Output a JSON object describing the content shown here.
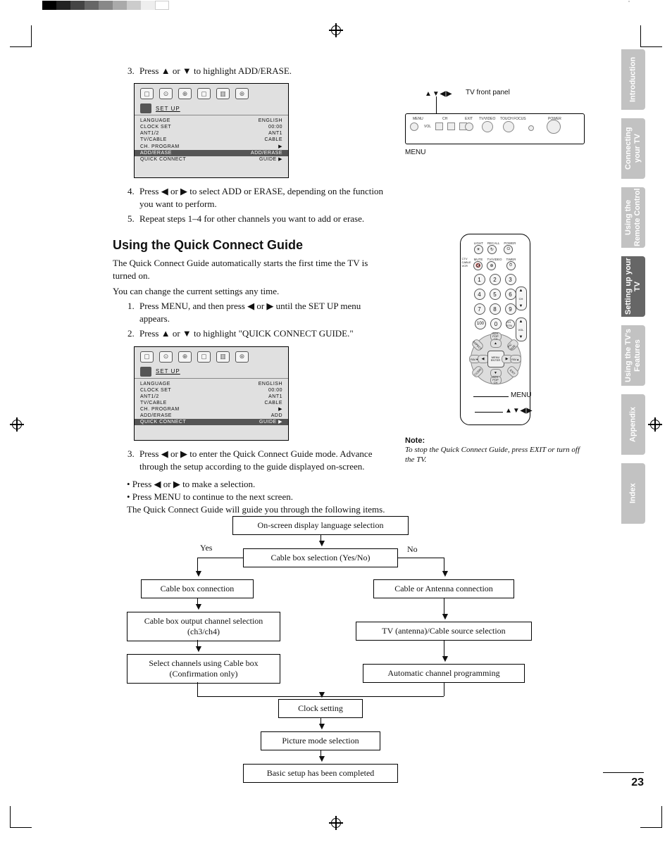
{
  "steps_a": {
    "s3": "Press ▲ or ▼ to highlight ADD/ERASE.",
    "s4": "Press ◀ or ▶ to select ADD or ERASE, depending on the function you want to perform.",
    "s5": "Repeat steps 1–4 for other channels you want to add or erase."
  },
  "osd1": {
    "title": "SET UP",
    "rows": [
      {
        "k": "LANGUAGE",
        "v": "ENGLISH"
      },
      {
        "k": "CLOCK SET",
        "v": "00:00"
      },
      {
        "k": "ANT1/2",
        "v": "ANT1"
      },
      {
        "k": "TV/CABLE",
        "v": "CABLE"
      },
      {
        "k": "CH. PROGRAM",
        "v": "▶"
      }
    ],
    "hl": {
      "k": "ADD/ERASE",
      "v": "ADD/ERASE"
    },
    "foot": {
      "k": "QUICK CONNECT",
      "v": "GUIDE             ▶"
    }
  },
  "section_title": "Using the Quick Connect Guide",
  "intro1": "The Quick Connect Guide automatically starts the first time the TV is turned on.",
  "intro2": "You can change the current settings any time.",
  "steps_b": {
    "s1": "Press MENU, and then press ◀ or ▶ until the SET UP menu appears.",
    "s2": "Press ▲ or ▼ to highlight \"QUICK CONNECT GUIDE.\""
  },
  "osd2": {
    "title": "SET UP",
    "rows": [
      {
        "k": "LANGUAGE",
        "v": "ENGLISH"
      },
      {
        "k": "CLOCK SET",
        "v": "00:00"
      },
      {
        "k": "ANT1/2",
        "v": "ANT1"
      },
      {
        "k": "TV/CABLE",
        "v": "CABLE"
      },
      {
        "k": "CH. PROGRAM",
        "v": "▶"
      },
      {
        "k": "ADD/ERASE",
        "v": "ADD"
      }
    ],
    "hl": {
      "k": "QUICK CONNECT",
      "v": "GUIDE             ▶"
    }
  },
  "steps_c": {
    "s3": "Press ◀ or ▶ to enter the Quick Connect Guide mode. Advance through the setup according to the guide displayed on-screen.",
    "b1": "• Press ◀ or ▶ to make a selection.",
    "b2": "• Press MENU to continue to the next screen.",
    "p": "The Quick Connect Guide will guide you through the following items."
  },
  "front_panel": {
    "label": "TV front panel",
    "nav": "▲▼◀▶",
    "menu": "MENU",
    "b_menu": "MENU",
    "b_vol": "VOL",
    "b_ch": "CH",
    "b_exit": "EXIT",
    "b_tvvideo": "TV/VIDEO",
    "b_touch": "TOUCH FOCUS",
    "b_power": "POWER"
  },
  "remote": {
    "top": {
      "light": "LIGHT",
      "recall": "RECALL",
      "power": "POWER"
    },
    "side": {
      "ctv": "CTV",
      "cable": "CABLE",
      "vcr": "VCR"
    },
    "r2": {
      "mute": "MUTE",
      "tvvideo": "TV/VIDEO",
      "timer": "TIMER"
    },
    "ch": "CH",
    "vol": "VOL",
    "chrtn": "CH RTN",
    "adv": "ADV.\nPOP CH",
    "menu": "MENU\nENTER",
    "fav": "FAV",
    "menu_label": "MENU",
    "nav_label": "▲▼◀▶"
  },
  "note": {
    "title": "Note:",
    "body": "To stop the Quick Connect Guide, press EXIT or turn off the TV."
  },
  "flow": {
    "b1": "On-screen display language selection",
    "b2": "Cable box selection (Yes/No)",
    "yes": "Yes",
    "no": "No",
    "b3": "Cable box connection",
    "b4": "Cable or Antenna connection",
    "b5": "Cable box output channel selection (ch3/ch4)",
    "b6": "TV (antenna)/Cable source selection",
    "b7": "Select channels using Cable box (Confirmation only)",
    "b8": "Automatic channel programming",
    "b9": "Clock setting",
    "b10": "Picture mode selection",
    "b11": "Basic setup has been completed"
  },
  "tabs": [
    "Introduction",
    "Connecting your TV",
    "Using the Remote Control",
    "Setting up your TV",
    "Using the TV's Features",
    "Appendix",
    "Index"
  ],
  "active_tab": 3,
  "page_number": "23"
}
